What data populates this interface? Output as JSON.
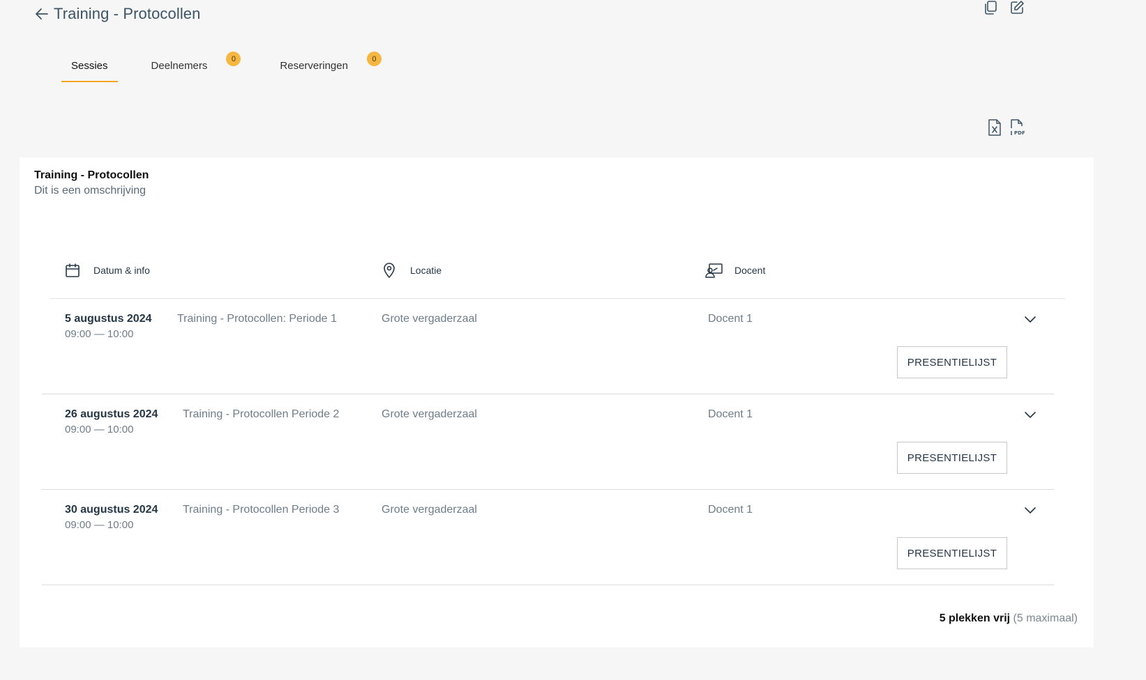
{
  "header": {
    "back_icon": "arrow-left-icon",
    "title": "Training - Protocollen",
    "actions": [
      {
        "icon": "copy-icon"
      },
      {
        "icon": "edit-icon"
      }
    ]
  },
  "tabs": [
    {
      "label": "Sessies",
      "active": true
    },
    {
      "label": "Deelnemers",
      "badge": "0"
    },
    {
      "label": "Reserveringen",
      "badge": "0"
    }
  ],
  "export": [
    {
      "icon": "excel-file-icon"
    },
    {
      "icon": "pdf-file-icon"
    }
  ],
  "accent_color": "#f5a623",
  "badge_color": "#f5b642",
  "card": {
    "title": "Training - Protocollen",
    "description": "Dit is een omschrijving",
    "columns": [
      {
        "icon": "calendar-icon",
        "label": "Datum & info"
      },
      {
        "icon": "location-pin-icon",
        "label": "Locatie"
      },
      {
        "icon": "teacher-icon",
        "label": "Docent"
      }
    ],
    "sessions": [
      {
        "date": "5 augustus 2024",
        "name": "Training - Protocollen: Periode 1",
        "time": "09:00 — 10:00",
        "location": "Grote vergaderzaal",
        "teacher": "Docent 1",
        "button": "PRESENTIELIJST"
      },
      {
        "date": "26 augustus 2024",
        "name": "Training - Protocollen Periode 2",
        "time": "09:00 — 10:00",
        "location": "Grote vergaderzaal",
        "teacher": "Docent 1",
        "button": "PRESENTIELIJST"
      },
      {
        "date": "30 augustus 2024",
        "name": "Training - Protocollen Periode 3",
        "time": "09:00 — 10:00",
        "location": "Grote vergaderzaal",
        "teacher": "Docent 1",
        "button": "PRESENTIELIJST"
      }
    ],
    "availability": {
      "free": "5 plekken vrij",
      "max": "(5 maximaal)"
    }
  }
}
